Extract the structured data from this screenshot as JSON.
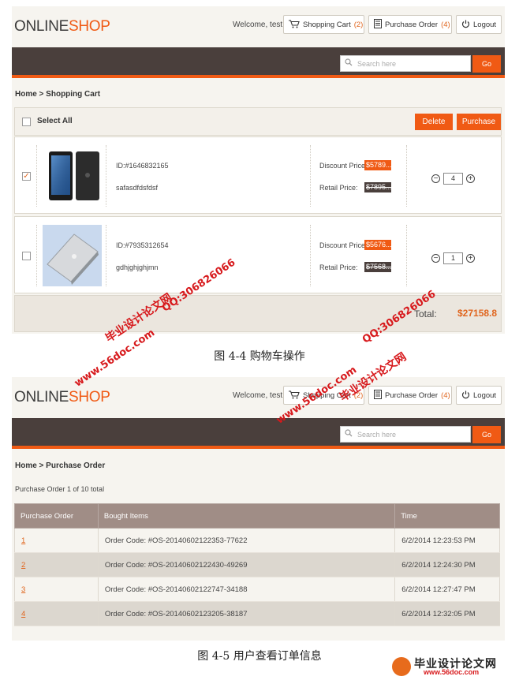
{
  "colors": {
    "accent": "#f05a14",
    "nav_dark": "#4a3f3c",
    "table_header": "#a08d86"
  },
  "header": {
    "logo_part1": "ONLINE",
    "logo_part2": "SHOP",
    "welcome": "Welcome, test",
    "cart_label": "Shopping Cart",
    "cart_count": "(2)",
    "order_label": "Purchase Order",
    "order_count": "(4)",
    "logout_label": "Logout"
  },
  "search": {
    "placeholder": "Search here",
    "go_label": "Go"
  },
  "cart_page": {
    "breadcrumb": "Home > Shopping Cart",
    "select_all": "Select All",
    "delete_label": "Delete",
    "purchase_label": "Purchase",
    "discount_label": "Discount Price:",
    "retail_label": "Retail Price:",
    "items": [
      {
        "id": "ID:#1646832165",
        "name": "safasdfdsfdsf",
        "discount": "$5789...",
        "retail": "$7895...",
        "qty": "4",
        "checked": true,
        "image": "tablet-image"
      },
      {
        "id": "ID:#7935312654",
        "name": "gdhjghjghjmn",
        "discount": "$5676...",
        "retail": "$7568...",
        "qty": "1",
        "checked": false,
        "image": "laptop-image"
      }
    ],
    "total_label": "Total:",
    "total_value": "$27158.8"
  },
  "caption1": "图 4-4   购物车操作",
  "order_page": {
    "breadcrumb": "Home > Purchase Order",
    "count_text": "Purchase Order 1 of 10 total",
    "columns": [
      "Purchase Order",
      "Bought Items",
      "Time"
    ],
    "rows": [
      {
        "no": "1",
        "items": "Order Code: #OS-20140602122353-77622",
        "time": "6/2/2014 12:23:53 PM"
      },
      {
        "no": "2",
        "items": "Order Code: #OS-20140602122430-49269",
        "time": "6/2/2014 12:24:30 PM"
      },
      {
        "no": "3",
        "items": "Order Code: #OS-20140602122747-34188",
        "time": "6/2/2014 12:27:47 PM"
      },
      {
        "no": "4",
        "items": "Order Code: #OS-20140602123205-38187",
        "time": "6/2/2014 12:32:05 PM"
      }
    ]
  },
  "caption2": "图 4-5   用户查看订单信息",
  "watermarks": {
    "site": "www.56doc.com",
    "qq": "QQ:306826066",
    "brand": "毕业设计论文网"
  },
  "footer_logo": {
    "name": "毕业设计论文网",
    "url": "www.56doc.com"
  }
}
